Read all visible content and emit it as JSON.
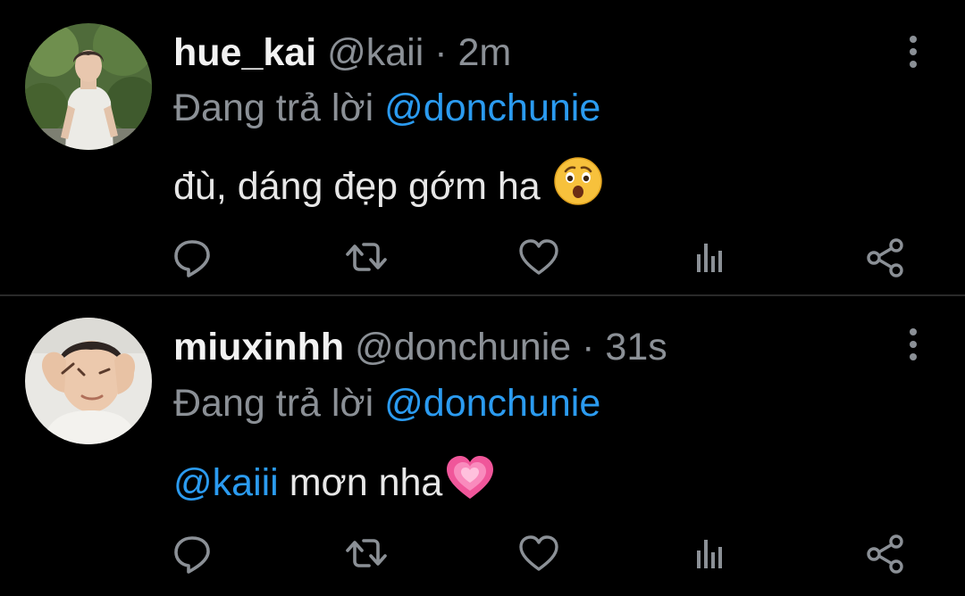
{
  "tweets": [
    {
      "display_name": "hue_kai",
      "handle": "@kaii",
      "separator": "·",
      "time": "2m",
      "reply_prefix": "Đang trả lời",
      "reply_to": "@donchunie",
      "body_mention": "",
      "body_text": "đù, dáng đẹp gớm ha",
      "emoji": "hushed-face-icon"
    },
    {
      "display_name": "miuxinhh",
      "handle": "@donchunie",
      "separator": "·",
      "time": "31s",
      "reply_prefix": "Đang trả lời",
      "reply_to": "@donchunie",
      "body_mention": "@kaiii",
      "body_text": "mơn nha",
      "emoji": "growing-heart-icon"
    }
  ],
  "colors": {
    "background": "#000000",
    "name": "#f2f2f2",
    "muted": "#8b9096",
    "mention": "#2b9bf0",
    "divider": "#2a2a2a"
  },
  "actions": [
    "reply-icon",
    "retweet-icon",
    "like-icon",
    "stats-icon",
    "share-icon"
  ]
}
